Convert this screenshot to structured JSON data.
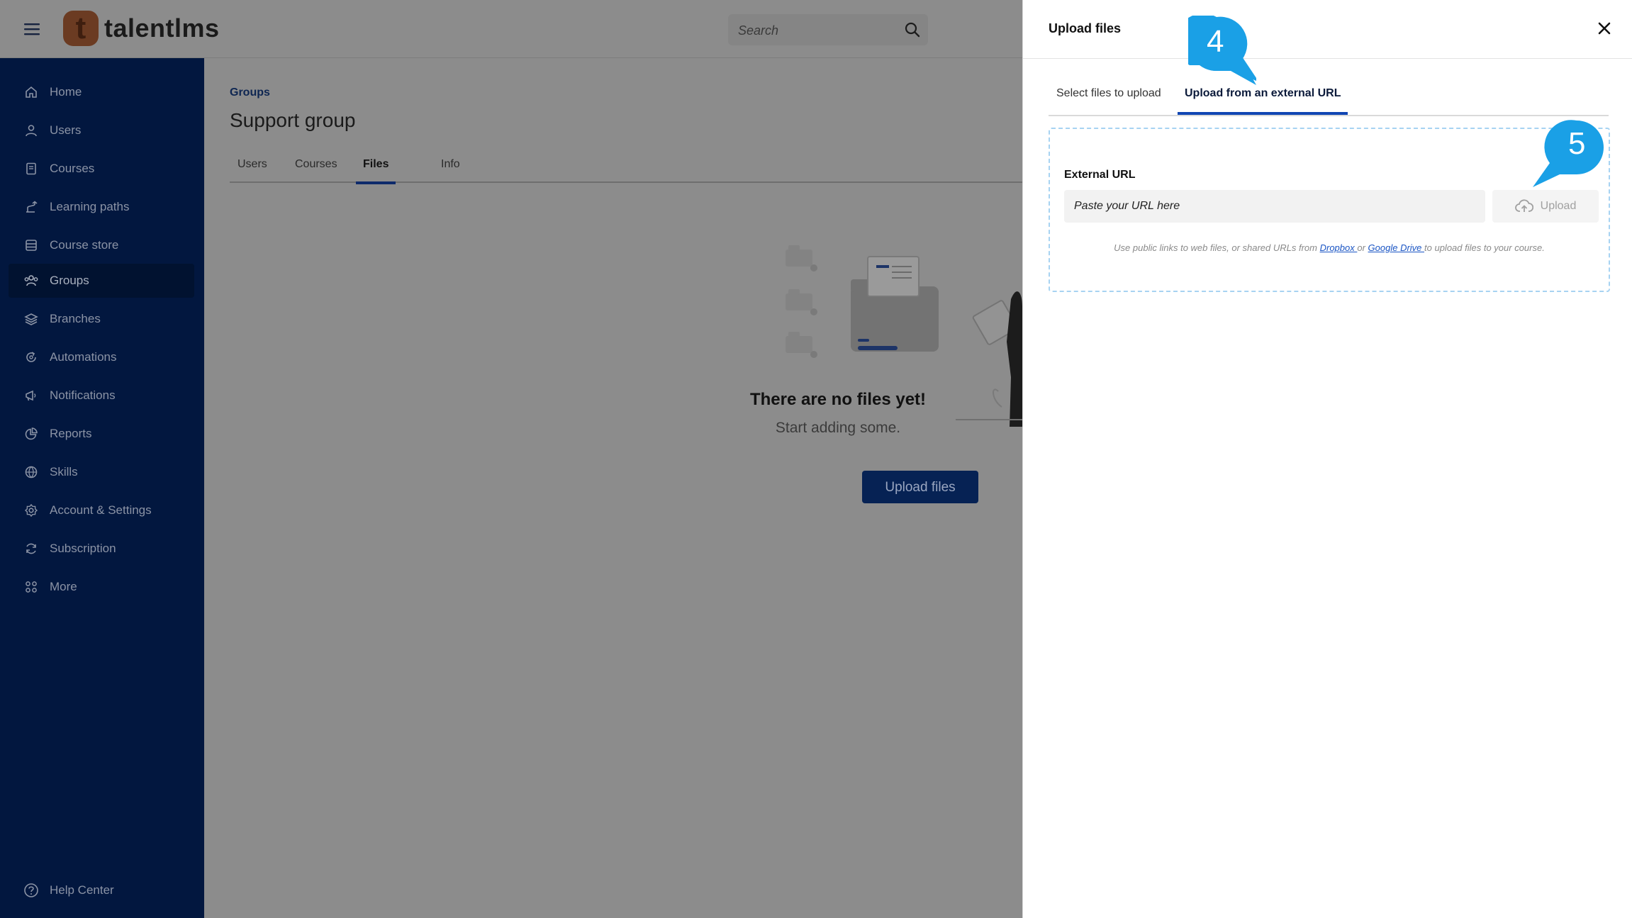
{
  "header": {
    "logo_mark": "t",
    "logo_text": "talentlms",
    "search_placeholder": "Search"
  },
  "sidebar": {
    "items": [
      {
        "label": "Home",
        "icon": "home-icon"
      },
      {
        "label": "Users",
        "icon": "user-icon"
      },
      {
        "label": "Courses",
        "icon": "book-icon"
      },
      {
        "label": "Learning paths",
        "icon": "path-icon"
      },
      {
        "label": "Course store",
        "icon": "store-icon"
      },
      {
        "label": "Groups",
        "icon": "groups-icon",
        "active": true
      },
      {
        "label": "Branches",
        "icon": "layers-icon"
      },
      {
        "label": "Automations",
        "icon": "automation-icon"
      },
      {
        "label": "Notifications",
        "icon": "megaphone-icon"
      },
      {
        "label": "Reports",
        "icon": "pie-chart-icon"
      },
      {
        "label": "Skills",
        "icon": "globe-icon"
      },
      {
        "label": "Account & Settings",
        "icon": "gear-icon"
      },
      {
        "label": "Subscription",
        "icon": "refresh-icon"
      },
      {
        "label": "More",
        "icon": "grid-icon"
      }
    ],
    "help_label": "Help Center"
  },
  "main": {
    "breadcrumb": "Groups",
    "title": "Support group",
    "tabs": [
      {
        "label": "Users"
      },
      {
        "label": "Courses"
      },
      {
        "label": "Files",
        "active": true
      },
      {
        "label": "Info"
      }
    ],
    "empty_title": "There are no files yet!",
    "empty_subtitle": "Start adding some.",
    "upload_button": "Upload files"
  },
  "panel": {
    "title": "Upload files",
    "tabs": [
      {
        "label": "Select files to upload"
      },
      {
        "label": "Upload from an external URL",
        "active": true
      }
    ],
    "url_label": "External URL",
    "url_placeholder": "Paste your URL here",
    "upload_button": "Upload",
    "hint_before": "Use public links to web files, or shared URLs from ",
    "hint_link1": "Dropbox ",
    "hint_mid": "or ",
    "hint_link2": "Google Drive ",
    "hint_after": "to upload files to your course."
  },
  "callouts": [
    {
      "number": "4"
    },
    {
      "number": "5"
    }
  ],
  "colors": {
    "sidebar_bg": "#02173f",
    "accent_blue": "#1146b3",
    "callout_blue": "#1aa0e6",
    "brand_orange": "#d9621f"
  }
}
